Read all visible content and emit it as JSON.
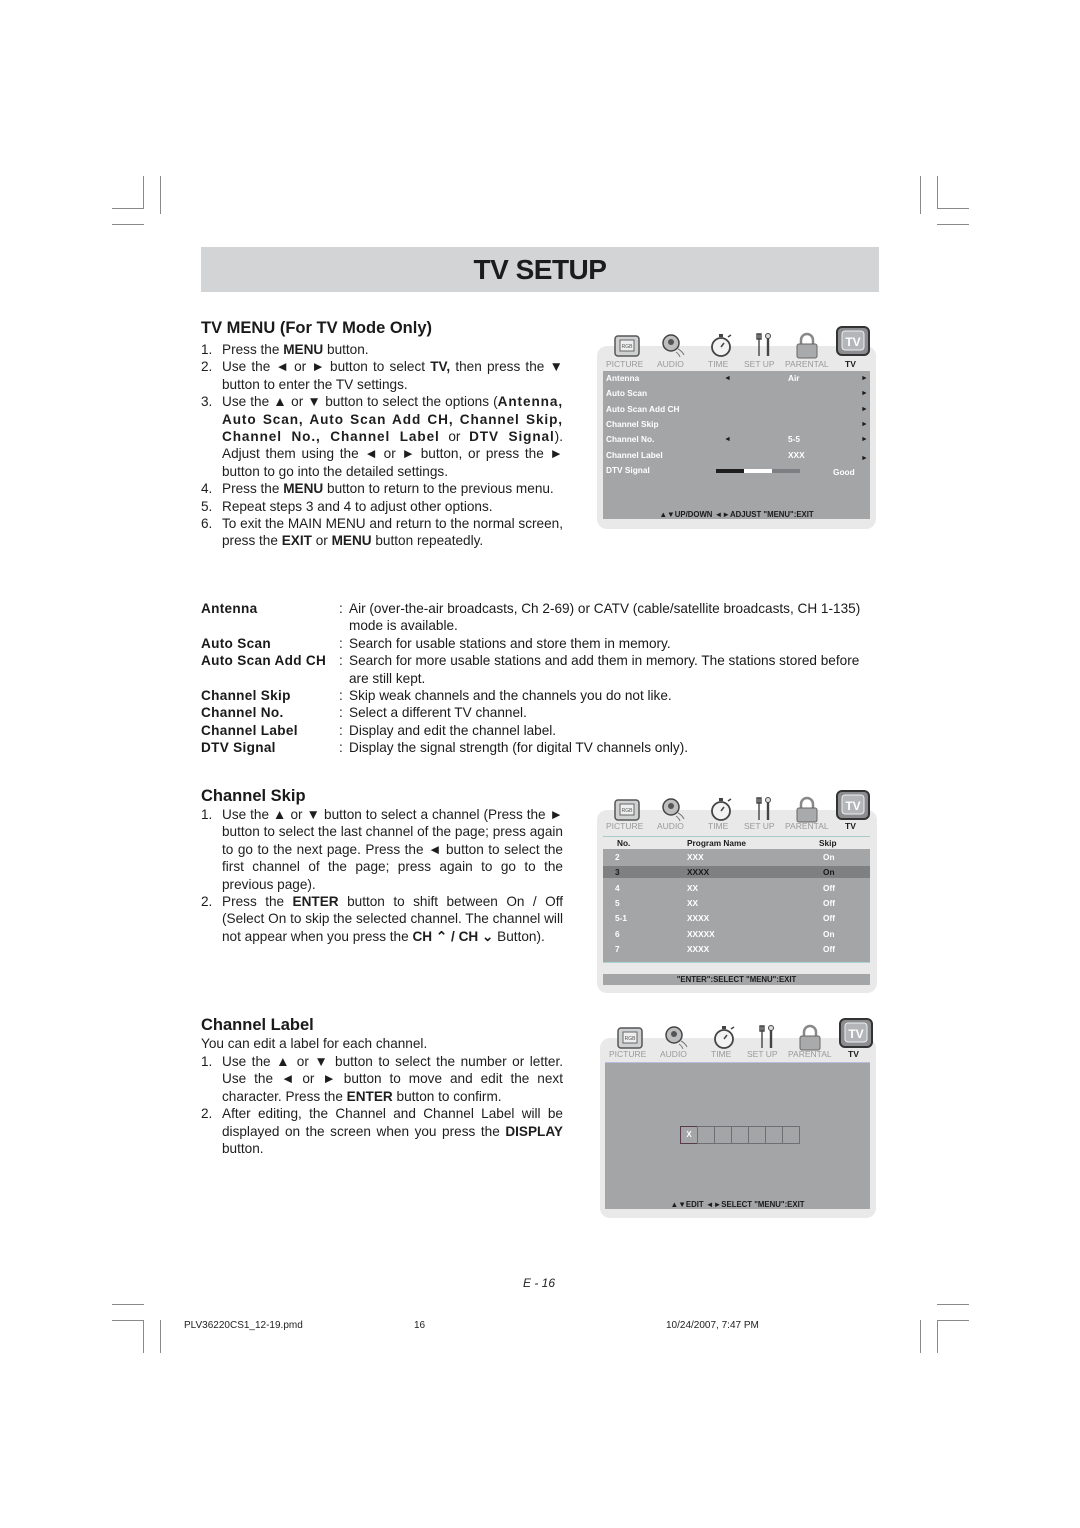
{
  "page_title": "TV SETUP",
  "tv_menu": {
    "heading": "TV MENU (For TV Mode Only)",
    "steps": [
      {
        "num": "1.",
        "parts": [
          "Press the ",
          "MENU",
          " button."
        ]
      },
      {
        "num": "2.",
        "parts": [
          "Use the ◄ or ► button to select ",
          "TV,",
          " then press the ▼ button to enter the TV settings."
        ]
      },
      {
        "num": "3.",
        "parts": [
          "Use the ▲ or ▼ button to select the options (",
          "Antenna, Auto Scan, Auto Scan Add CH, Channel Skip, Channel No., Channel Label",
          " or ",
          "DTV Signal",
          "). Adjust them using the ◄ or ► button, or press the ► button to go into the detailed settings."
        ]
      },
      {
        "num": "4.",
        "parts": [
          "Press the ",
          "MENU",
          " button to return to the previous menu."
        ]
      },
      {
        "num": "5.",
        "parts": [
          "Repeat steps 3 and 4 to adjust other options."
        ]
      },
      {
        "num": "6.",
        "parts": [
          "To exit the MAIN MENU and return to the normal screen, press the ",
          "EXIT",
          " or ",
          "MENU",
          " button repeatedly."
        ]
      }
    ]
  },
  "osd_tabs": [
    "PICTURE",
    "AUDIO",
    "TIME",
    "SET UP",
    "PARENTAL",
    "TV"
  ],
  "osd_icons": [
    "picture-icon",
    "audio-icon",
    "time-icon",
    "setup-icon",
    "parental-icon",
    "tv-icon"
  ],
  "osd_tv_icon_label": "TV",
  "osd_picture_icon_label": "RGB",
  "tv_osd": {
    "rows": [
      {
        "label": "Antenna",
        "left_arrow": "◄",
        "value": "Air",
        "right_arrow": "►"
      },
      {
        "label": "Auto Scan",
        "left_arrow": "",
        "value": "",
        "right_arrow": "►"
      },
      {
        "label": "Auto Scan Add CH",
        "left_arrow": "",
        "value": "",
        "right_arrow": "►"
      },
      {
        "label": "Channel Skip",
        "left_arrow": "",
        "value": "",
        "right_arrow": "►"
      },
      {
        "label": "Channel No.",
        "left_arrow": "◄",
        "value": "5-5",
        "right_arrow": "►"
      },
      {
        "label": "Channel Label",
        "left_arrow": "",
        "value": "XXX",
        "right_arrow": "►"
      }
    ],
    "dtv_signal_label": "DTV Signal",
    "dtv_signal_value": "Good",
    "dtv_signal_segments": [
      "#1e1e1e",
      "#ffffff",
      "#7e7f82"
    ],
    "hint": "▲▼UP/DOWN  ◄►ADJUST  \"MENU\":EXIT"
  },
  "definitions": [
    {
      "term": "Antenna",
      "desc": "Air (over-the-air broadcasts, Ch 2-69) or CATV (cable/satellite broadcasts, CH 1-135) mode is available."
    },
    {
      "term": "Auto Scan",
      "desc": "Search for usable stations and store them in memory."
    },
    {
      "term": "Auto Scan Add CH",
      "desc": "Search for more usable stations and add them in memory. The stations stored before are still kept."
    },
    {
      "term": "Channel Skip",
      "desc": "Skip weak channels and the channels you do not like."
    },
    {
      "term": "Channel No.",
      "desc": "Select a different TV channel."
    },
    {
      "term": "Channel Label",
      "desc": "Display and edit the channel label."
    },
    {
      "term": "DTV Signal",
      "desc": "Display the signal strength (for digital TV channels only)."
    }
  ],
  "channel_skip": {
    "heading": "Channel Skip",
    "steps": [
      {
        "num": "1.",
        "parts": [
          "Use the ▲ or ▼ button to select a channel (Press the ► button to select the last channel of the page; press again to go to the next page. Press the ◄ button to select the first channel of the page; press again to go to the previous page)."
        ]
      },
      {
        "num": "2.",
        "parts": [
          "Press the ",
          "ENTER",
          " button to shift between On / Off (Select On to skip the selected channel. The channel will not appear when you press the ",
          "CH ⌃ / CH ⌄",
          " Button)."
        ]
      }
    ],
    "osd": {
      "columns": [
        "No.",
        "Program Name",
        "Skip"
      ],
      "rows": [
        {
          "no": "2",
          "name": "XXX",
          "skip": "On",
          "selected": false
        },
        {
          "no": "3",
          "name": "XXXX",
          "skip": "On",
          "selected": true
        },
        {
          "no": "4",
          "name": "XX",
          "skip": "Off",
          "selected": false
        },
        {
          "no": "5",
          "name": "XX",
          "skip": "Off",
          "selected": false
        },
        {
          "no": "5-1",
          "name": "XXXX",
          "skip": "Off",
          "selected": false
        },
        {
          "no": "6",
          "name": "XXXXX",
          "skip": "On",
          "selected": false
        },
        {
          "no": "7",
          "name": "XXXX",
          "skip": "Off",
          "selected": false
        }
      ],
      "hint": "\"ENTER\":SELECT   \"MENU\":EXIT"
    }
  },
  "channel_label": {
    "heading": "Channel Label",
    "intro": "You can edit a label for each channel.",
    "steps": [
      {
        "num": "1.",
        "parts": [
          "Use the ▲ or ▼ button to select the number or letter. Use the ◄ or ► button to move and edit the next character. Press the ",
          "ENTER",
          " button to confirm."
        ]
      },
      {
        "num": "2.",
        "parts": [
          "After editing, the Channel and Channel Label will be displayed on the screen when you press the ",
          "DISPLAY",
          " button."
        ]
      }
    ],
    "osd": {
      "chars": [
        "X",
        "",
        "",
        "",
        "",
        "",
        ""
      ],
      "hint": "▲▼EDIT  ◄►SELECT  \"MENU\":EXIT"
    }
  },
  "page_number": "E - 16",
  "footer": {
    "file": "PLV36220CS1_12-19.pmd",
    "page": "16",
    "timestamp": "10/24/2007, 7:47 PM"
  }
}
